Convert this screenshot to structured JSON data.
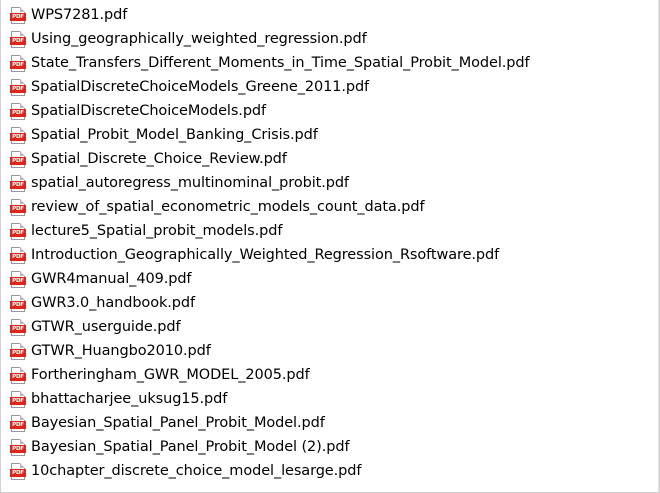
{
  "file_list": {
    "icon": "pdf-file-icon",
    "icon_badge_text": "PDF",
    "items": [
      "WPS7281.pdf",
      "Using_geographically_weighted_regression.pdf",
      "State_Transfers_Different_Moments_in_Time_Spatial_Probit_Model.pdf",
      "SpatialDiscreteChoiceModels_Greene_2011.pdf",
      "SpatialDiscreteChoiceModels.pdf",
      "Spatial_Probit_Model_Banking_Crisis.pdf",
      "Spatial_Discrete_Choice_Review.pdf",
      "spatial_autoregress_multinominal_probit.pdf",
      "review_of_spatial_econometric_models_count_data.pdf",
      "lecture5_Spatial_probit_models.pdf",
      "Introduction_Geographically_Weighted_Regression_Rsoftware.pdf",
      "GWR4manual_409.pdf",
      "GWR3.0_handbook.pdf",
      "GTWR_userguide.pdf",
      "GTWR_Huangbo2010.pdf",
      "Fortheringham_GWR_MODEL_2005.pdf",
      "bhattacharjee_uksug15.pdf",
      "Bayesian_Spatial_Panel_Probit_Model.pdf",
      "Bayesian_Spatial_Panel_Probit_Model (2).pdf",
      "10chapter_discrete_choice_model_lesarge.pdf"
    ]
  },
  "colors": {
    "pdf_icon_red": "#d9261c",
    "text": "#000000",
    "background": "#ffffff"
  }
}
